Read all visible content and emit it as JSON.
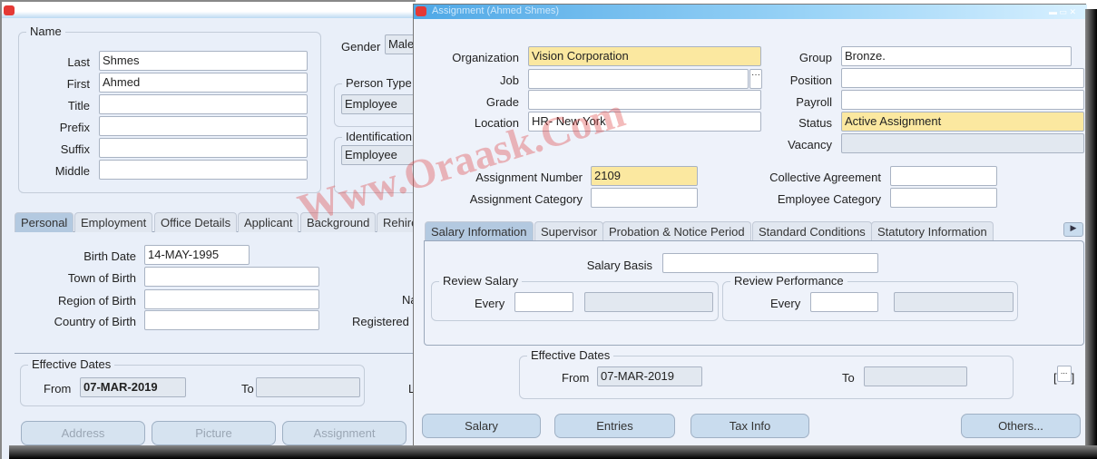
{
  "watermark": "Www.Oraask.Com",
  "left_window": {
    "name_group": {
      "title": "Name",
      "fields": [
        {
          "label": "Last",
          "value": "Shmes"
        },
        {
          "label": "First",
          "value": "Ahmed"
        },
        {
          "label": "Title",
          "value": ""
        },
        {
          "label": "Prefix",
          "value": ""
        },
        {
          "label": "Suffix",
          "value": ""
        },
        {
          "label": "Middle",
          "value": ""
        }
      ]
    },
    "gender": {
      "label": "Gender",
      "value": "Male"
    },
    "person_type": {
      "title": "Person Type",
      "value": "Employee"
    },
    "identification": {
      "title": "Identification",
      "value": "Employee"
    },
    "tabs": [
      "Personal",
      "Employment",
      "Office Details",
      "Applicant",
      "Background",
      "Rehire"
    ],
    "personal": {
      "birth_date_label": "Birth Date",
      "birth_date": "14-MAY-1995",
      "town_label": "Town of Birth",
      "region_label": "Region of Birth",
      "country_label": "Country of Birth",
      "na_label": "Na",
      "registered_label": "Registered"
    },
    "effective_dates": {
      "title": "Effective Dates",
      "from_label": "From",
      "from": "07-MAR-2019",
      "to_label": "To",
      "to": "",
      "l_label": "L"
    },
    "buttons": {
      "address": "Address",
      "picture": "Picture",
      "assignment": "Assignment"
    }
  },
  "assignment_window": {
    "title": "Assignment (Ahmed Shmes)",
    "organization": {
      "label": "Organization",
      "value": "Vision Corporation"
    },
    "job": {
      "label": "Job",
      "value": ""
    },
    "grade": {
      "label": "Grade",
      "value": ""
    },
    "location": {
      "label": "Location",
      "value": "HR- New York"
    },
    "group": {
      "label": "Group",
      "value": "Bronze."
    },
    "position": {
      "label": "Position",
      "value": ""
    },
    "payroll": {
      "label": "Payroll",
      "value": ""
    },
    "status": {
      "label": "Status",
      "value": "Active Assignment"
    },
    "vacancy": {
      "label": "Vacancy",
      "value": ""
    },
    "assignment_number": {
      "label": "Assignment Number",
      "value": "2109"
    },
    "assignment_category": {
      "label": "Assignment Category",
      "value": ""
    },
    "collective_agreement": {
      "label": "Collective Agreement",
      "value": ""
    },
    "employee_category": {
      "label": "Employee Category",
      "value": ""
    },
    "tabs": [
      "Salary Information",
      "Supervisor",
      "Probation & Notice Period",
      "Standard Conditions",
      "Statutory Information"
    ],
    "salary_basis_label": "Salary Basis",
    "review_salary": {
      "title": "Review Salary",
      "every_label": "Every"
    },
    "review_performance": {
      "title": "Review Performance",
      "every_label": "Every"
    },
    "effective_dates": {
      "title": "Effective Dates",
      "from_label": "From",
      "from": "07-MAR-2019",
      "to_label": "To",
      "to": ""
    },
    "dff": "...",
    "buttons": {
      "salary": "Salary",
      "entries": "Entries",
      "tax_info": "Tax Info",
      "others": "Others..."
    }
  }
}
